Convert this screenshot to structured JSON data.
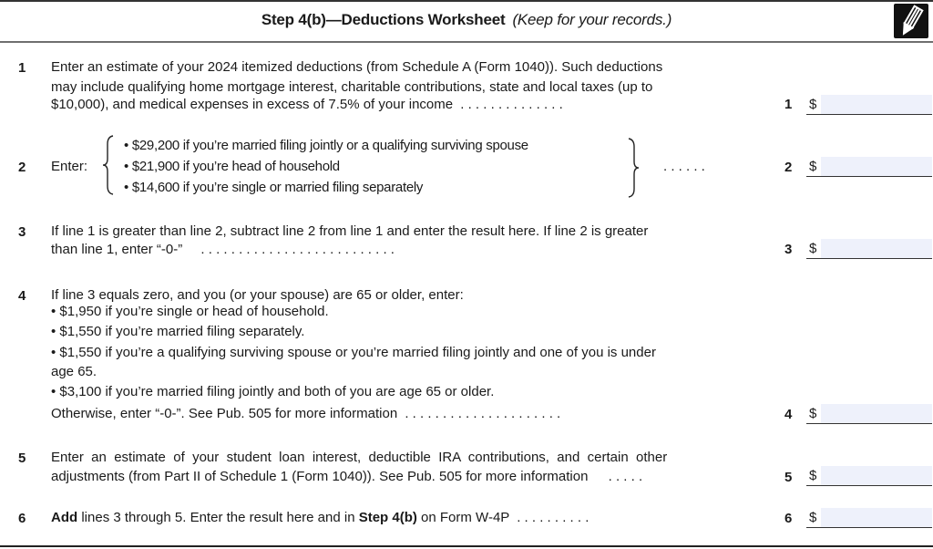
{
  "header": {
    "title_bold": "Step 4(b)—Deductions Worksheet",
    "title_italic": "(Keep for your records.)",
    "icon": "pencil-icon"
  },
  "lines": [
    {
      "number": "1",
      "text": [
        "Enter an estimate of your 2024 itemized deductions (from Schedule A (Form 1040)). Such deductions",
        "may include qualifying home mortgage interest, charitable contributions, state and local taxes (up to",
        "$10,000), and medical expenses in excess of 7.5% of your income"
      ],
      "dots": ". . . . . . . . . . . . . .",
      "ref": "1",
      "currency": "$",
      "value": ""
    },
    {
      "number": "2",
      "label": "Enter:",
      "options": [
        "• $29,200 if you’re married filing jointly or a qualifying surviving spouse",
        "• $21,900 if you’re head of household",
        "• $14,600 if you’re single or married filing separately"
      ],
      "dots": ". . . . . .",
      "ref": "2",
      "currency": "$",
      "value": ""
    },
    {
      "number": "3",
      "text": [
        "If line 1 is greater than line 2, subtract line 2 from line 1 and enter the result here. If line 2 is greater",
        "than line 1, enter “-0-”"
      ],
      "dots": ". . . . . . . . . . . . . . . . . . . . . . . . . .",
      "ref": "3",
      "currency": "$",
      "value": ""
    },
    {
      "number": "4",
      "text": [
        "If line 3 equals zero, and you (or your spouse) are 65 or older, enter:",
        "• $1,950 if you’re single or head of household.",
        "• $1,550 if you’re married filing separately.",
        "• $1,550 if you’re a qualifying surviving spouse or you’re married filing jointly and one of you is under",
        "age 65.",
        "• $3,100 if you’re married filing jointly and both of you are age 65 or older.",
        "Otherwise, enter “-0-”. See Pub. 505 for more information"
      ],
      "dots": ". . . . . . . . . . . . . . . . . . . . .",
      "ref": "4",
      "currency": "$",
      "value": ""
    },
    {
      "number": "5",
      "text": [
        "Enter  an  estimate  of  your  student  loan  interest,  deductible  IRA  contributions,  and  certain  other",
        "adjustments (from Part II of Schedule 1 (Form 1040)). See Pub. 505 for more information"
      ],
      "dots": ". . . . .",
      "ref": "5",
      "currency": "$",
      "value": ""
    },
    {
      "number": "6",
      "text_bold_1": "Add",
      "text_1": " lines 3 through 5. Enter the result here and in ",
      "text_bold_2": "Step 4(b)",
      "text_2": " on Form W-4P",
      "dots": ". . . . . . . . . .",
      "ref": "6",
      "currency": "$",
      "value": ""
    }
  ]
}
